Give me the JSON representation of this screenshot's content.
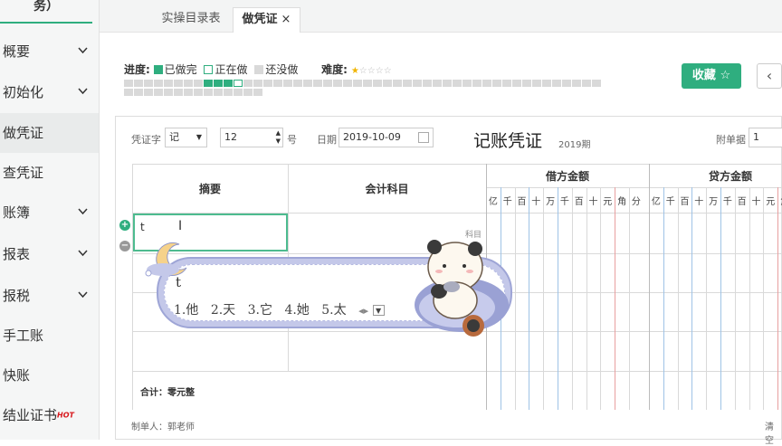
{
  "sidebar": {
    "top_text": "务）",
    "items": [
      {
        "label": "概要",
        "has_chevron": true
      },
      {
        "label": "初始化",
        "has_chevron": true
      },
      {
        "label": "做凭证",
        "has_chevron": false,
        "active": true
      },
      {
        "label": "查凭证",
        "has_chevron": false
      },
      {
        "label": "账簿",
        "has_chevron": true
      },
      {
        "label": "报表",
        "has_chevron": true
      },
      {
        "label": "报税",
        "has_chevron": true
      },
      {
        "label": "手工账",
        "has_chevron": false
      },
      {
        "label": "快账",
        "has_chevron": false
      },
      {
        "label": "结业证书",
        "has_chevron": false,
        "badge": "HOT"
      }
    ]
  },
  "tabs": [
    {
      "label": "实操目录表"
    },
    {
      "label": "做凭证",
      "close": "×"
    }
  ],
  "progress": {
    "label": "进度:",
    "done_label": "已做完",
    "doing_label": "正在做",
    "todo_label": "还没做",
    "difficulty_label": "难度:",
    "difficulty_value": 1,
    "difficulty_max": 5,
    "colors": {
      "done": "#2fae7f",
      "todo": "#d9d9d9"
    }
  },
  "favorite_button": {
    "label": "收藏",
    "icon": "star-outline-icon"
  },
  "prev_button": {
    "icon": "chevron-left-icon",
    "glyph": "‹"
  },
  "voucher": {
    "word_label": "凭证字",
    "word_value": "记",
    "number_value": "12",
    "number_unit": "号",
    "date_label": "日期",
    "date_value": "2019-10-09",
    "title": "记账凭证",
    "period": "2019期",
    "attach_label": "附单据",
    "attach_value": "1",
    "headers": {
      "summary": "摘要",
      "account": "会计科目",
      "debit": "借方金额",
      "credit": "贷方金额"
    },
    "digits": [
      "亿",
      "千",
      "百",
      "十",
      "万",
      "千",
      "百",
      "十",
      "元",
      "角",
      "分"
    ],
    "rows": [
      {
        "summary": "t",
        "account_hint": "科目"
      }
    ],
    "total_label": "合计：零元整",
    "maker": "制单人：郭老师",
    "clear_label": "清空"
  },
  "ime": {
    "composition": "t",
    "candidates": [
      "1.他",
      "2.天",
      "3.它",
      "4.她",
      "5.太"
    ]
  }
}
